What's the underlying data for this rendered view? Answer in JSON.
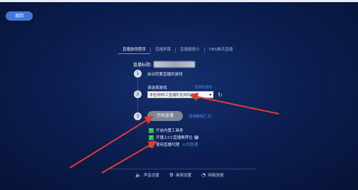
{
  "top_bar": {
    "back_label": "返回"
  },
  "tabs": [
    {
      "label": "直播游戏程序",
      "active": true
    },
    {
      "label": "直播屏幕",
      "active": false
    },
    {
      "label": "直播摄像头",
      "active": false
    },
    {
      "label": "OBS推流直播",
      "active": false
    }
  ],
  "title_row": {
    "label": "直播标题:"
  },
  "steps": {
    "s1": {
      "number": "1",
      "text": "启动您要直播的游戏"
    },
    "s2": {
      "number": "2",
      "label": "请选择游戏",
      "support_link": "支持的游戏",
      "selected_game": "未检测到CC直播所支持的游戏",
      "caret_icon": "caret-down-icon",
      "refresh_icon": "refresh-icon"
    },
    "s3": {
      "number": "3",
      "start_button": "开始直播",
      "help_link": "(直播教程汇总)"
    }
  },
  "options": [
    {
      "label": "开启内置工具条",
      "checked": true
    },
    {
      "label": "开播上CC直播推荐位",
      "checked": true,
      "icon": "help-icon"
    },
    {
      "label": "使用直播代理",
      "checked": true,
      "link": "山东联通"
    }
  ],
  "footer": {
    "items": [
      {
        "label": "声音设置",
        "icon": "speaker-icon"
      },
      {
        "label": "画面设置",
        "icon": "gear-icon"
      },
      {
        "label": "网络测速",
        "icon": "speed-icon"
      }
    ]
  },
  "colors": {
    "accent": "#3f78d8",
    "arrow": "#e23a2e",
    "checkbox": "#38b24a",
    "link": "#4f8cf0"
  }
}
